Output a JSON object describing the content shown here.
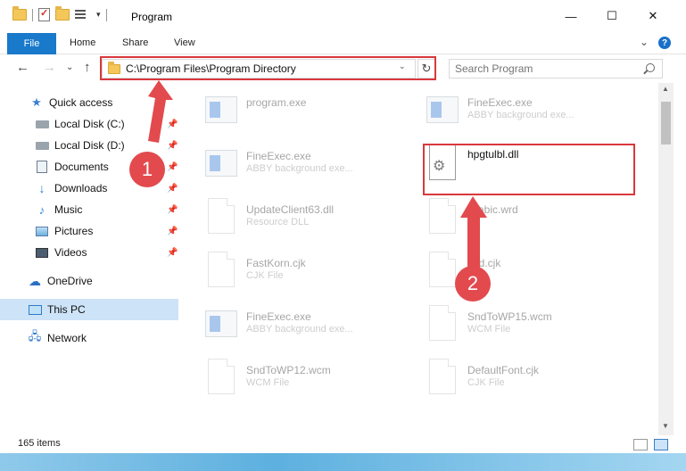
{
  "window": {
    "title": "Program",
    "minimize_glyph": "—",
    "maximize_glyph": "☐",
    "close_glyph": "✕"
  },
  "ribbon": {
    "tabs": [
      "File",
      "Home",
      "Share",
      "View"
    ],
    "expand_glyph": "⌄",
    "help_glyph": "?"
  },
  "address": {
    "path": "C:\\Program Files\\Program Directory",
    "back_glyph": "←",
    "forward_glyph": "→",
    "recent_glyph": "⌄",
    "up_glyph": "↑",
    "refresh_glyph": "↻",
    "dropdown_glyph": "⌄"
  },
  "search": {
    "placeholder": "Search Program"
  },
  "sidebar": {
    "items": [
      {
        "label": "Quick access",
        "icon": "star-icon",
        "pinned": false
      },
      {
        "label": "Local Disk (C:)",
        "icon": "disk-icon",
        "pinned": true
      },
      {
        "label": "Local Disk (D:)",
        "icon": "disk-icon",
        "pinned": true
      },
      {
        "label": "Documents",
        "icon": "documents-icon",
        "pinned": true
      },
      {
        "label": "Downloads",
        "icon": "download-icon",
        "pinned": true
      },
      {
        "label": "Music",
        "icon": "music-icon",
        "pinned": true
      },
      {
        "label": "Pictures",
        "icon": "pictures-icon",
        "pinned": true
      },
      {
        "label": "Videos",
        "icon": "videos-icon",
        "pinned": true
      },
      {
        "label": "OneDrive",
        "icon": "cloud-icon",
        "pinned": false
      },
      {
        "label": "This PC",
        "icon": "pc-icon",
        "pinned": false,
        "selected": true
      },
      {
        "label": "Network",
        "icon": "network-icon",
        "pinned": false
      }
    ]
  },
  "files": [
    {
      "name": "program.exe",
      "type": "",
      "icon": "exe-icon",
      "highlighted": false
    },
    {
      "name": "FineExec.exe",
      "type": "ABBY background exe...",
      "icon": "exe-icon",
      "highlighted": false
    },
    {
      "name": "FineExec.exe",
      "type": "ABBY background exe...",
      "icon": "exe-icon",
      "highlighted": false
    },
    {
      "name": "hpgtulbl.dll",
      "type": "",
      "icon": "dll-gear-icon",
      "highlighted": true
    },
    {
      "name": "UpdateClient63.dll",
      "type": "Resource DLL",
      "icon": "dll-icon",
      "highlighted": false
    },
    {
      "name": "Arabic.wrd",
      "type": "",
      "icon": "file-icon",
      "highlighted": false
    },
    {
      "name": "FastKorn.cjk",
      "type": "CJK File",
      "icon": "file-icon",
      "highlighted": false
    },
    {
      "name": "Ted.cjk",
      "type": "",
      "icon": "file-icon",
      "highlighted": false
    },
    {
      "name": "FineExec.exe",
      "type": "ABBY background exe...",
      "icon": "exe-icon",
      "highlighted": false
    },
    {
      "name": "SndToWP15.wcm",
      "type": "WCM File",
      "icon": "file-icon",
      "highlighted": false
    },
    {
      "name": "SndToWP12.wcm",
      "type": "WCM File",
      "icon": "file-icon",
      "highlighted": false
    },
    {
      "name": "DefaultFont.cjk",
      "type": "CJK File",
      "icon": "file-icon",
      "highlighted": false
    }
  ],
  "status": {
    "item_count": "165 items"
  },
  "annotations": {
    "step1": "1",
    "step2": "2",
    "color": "#e24a4e"
  },
  "colors": {
    "accent": "#1979ca",
    "selection": "#cde3f7",
    "highlight_box": "#d9383c"
  }
}
